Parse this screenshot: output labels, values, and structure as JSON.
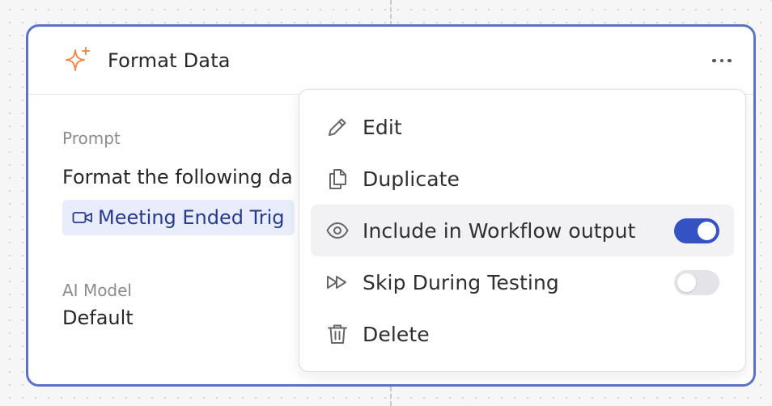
{
  "node": {
    "title": "Format Data",
    "icon": "sparkle-icon",
    "accent": "#5a73c8",
    "prompt_label": "Prompt",
    "prompt_text": "Format the following da",
    "variable_chip": "Meeting Ended Trig",
    "model_label": "AI Model",
    "model_value": "Default"
  },
  "menu": {
    "items": [
      {
        "label": "Edit",
        "icon": "pencil-icon"
      },
      {
        "label": "Duplicate",
        "icon": "duplicate-icon"
      },
      {
        "label": "Include in Workflow output",
        "icon": "eye-icon",
        "toggle": true
      },
      {
        "label": "Skip During Testing",
        "icon": "fast-forward-icon",
        "toggle": false
      },
      {
        "label": "Delete",
        "icon": "trash-icon"
      }
    ],
    "toggle_on_color": "#3452c2"
  }
}
